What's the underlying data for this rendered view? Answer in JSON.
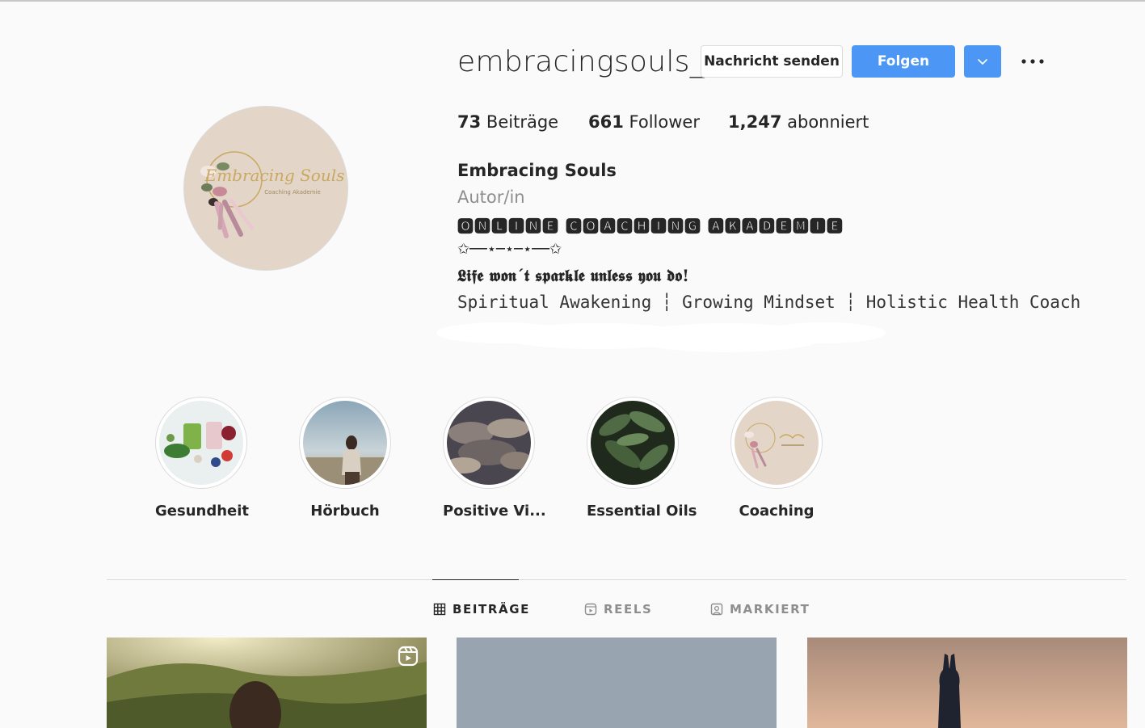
{
  "profile": {
    "username": "embracingsouls_",
    "buttons": {
      "message": "Nachricht senden",
      "follow": "Folgen"
    },
    "stats": {
      "posts_count": "73",
      "posts_label": "Beiträge",
      "followers_count": "661",
      "followers_label": "Follower",
      "following_count": "1,247",
      "following_label": "abonniert"
    },
    "full_name": "Embracing Souls",
    "category": "Autor/in",
    "bio": [
      "🅾🅽🅻🅸🅽🅴 🅲🅾🅰🅲🅷🅸🅽🅶 🅰🅺🅰🅳🅴🅼🅸🅴",
      "✩──⋆─⋆─⋆──✩",
      "𝕷𝖎𝖋𝖊 𝖜𝖔𝖓´𝖙 𝖘𝖕𝖆𝖗𝖐𝖑𝖊 𝖚𝖓𝖑𝖊𝖘𝖘 𝖞𝖔𝖚 𝖉𝖔!",
      "Spiritual Awakening ┆ Growing Mindset ┆ Holistic Health Coach"
    ],
    "avatar_logo_text": "Embracing Souls",
    "avatar_logo_subtext": "Coaching Akademie"
  },
  "highlights": [
    {
      "label": "Gesundheit"
    },
    {
      "label": "Hörbuch"
    },
    {
      "label": "Positive Vi..."
    },
    {
      "label": "Essential Oils"
    },
    {
      "label": "Coaching"
    }
  ],
  "tabs": [
    {
      "label": "BEITRÄGE",
      "icon": "grid-icon",
      "active": true
    },
    {
      "label": "REELS",
      "icon": "reels-icon",
      "active": false
    },
    {
      "label": "MARKIERT",
      "icon": "tagged-icon",
      "active": false
    }
  ],
  "colors": {
    "accent": "#4c97f5",
    "avatar_bg": "#e3d6c8"
  }
}
